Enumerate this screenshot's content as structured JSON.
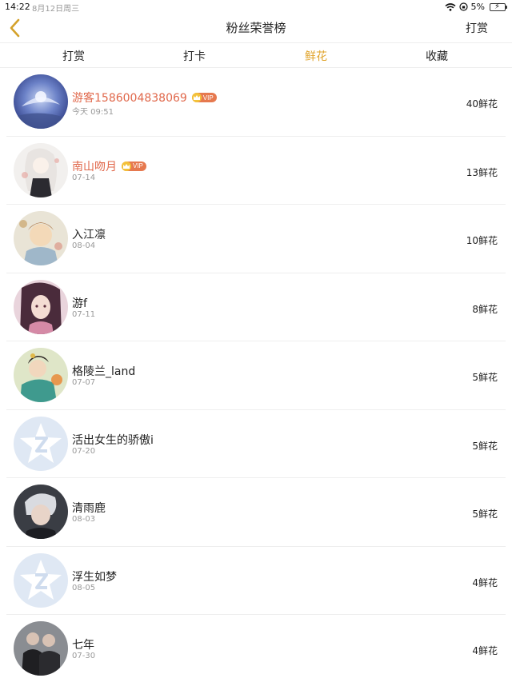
{
  "status_bar": {
    "time": "14:22",
    "date": "8月12日周三",
    "battery": "5%"
  },
  "nav": {
    "title": "粉丝荣誉榜",
    "action": "打赏",
    "back_icon": "chevron-left-icon"
  },
  "tabs": [
    {
      "label": "打赏",
      "active": false
    },
    {
      "label": "打卡",
      "active": false
    },
    {
      "label": "鲜花",
      "active": true
    },
    {
      "label": "收藏",
      "active": false
    }
  ],
  "colors": {
    "accent": "#e0a32a",
    "vip_name": "#e0674a"
  },
  "fans": [
    {
      "name": "游客1586004838069",
      "vip": true,
      "vip_label": "VIP",
      "date": "今天 09:51",
      "count": "40鲜花",
      "avatar": "avatar-galaxy"
    },
    {
      "name": "南山吻月",
      "vip": true,
      "vip_label": "VIP",
      "date": "07-14",
      "count": "13鲜花",
      "avatar": "avatar-white-hair"
    },
    {
      "name": "入江凛",
      "vip": false,
      "date": "08-04",
      "count": "10鲜花",
      "avatar": "avatar-illustration"
    },
    {
      "name": "游f",
      "vip": false,
      "date": "07-11",
      "count": "8鲜花",
      "avatar": "avatar-anime-girl"
    },
    {
      "name": "格陵兰_land",
      "vip": false,
      "date": "07-07",
      "count": "5鲜花",
      "avatar": "avatar-costume"
    },
    {
      "name": "活出女生的骄傲i",
      "vip": false,
      "date": "07-20",
      "count": "5鲜花",
      "avatar": "avatar-default"
    },
    {
      "name": "清雨鹿",
      "vip": false,
      "date": "08-03",
      "count": "5鲜花",
      "avatar": "avatar-photo"
    },
    {
      "name": "浮生如梦",
      "vip": false,
      "date": "08-05",
      "count": "4鲜花",
      "avatar": "avatar-default"
    },
    {
      "name": "七年",
      "vip": false,
      "date": "07-30",
      "count": "4鲜花",
      "avatar": "avatar-couple"
    }
  ]
}
